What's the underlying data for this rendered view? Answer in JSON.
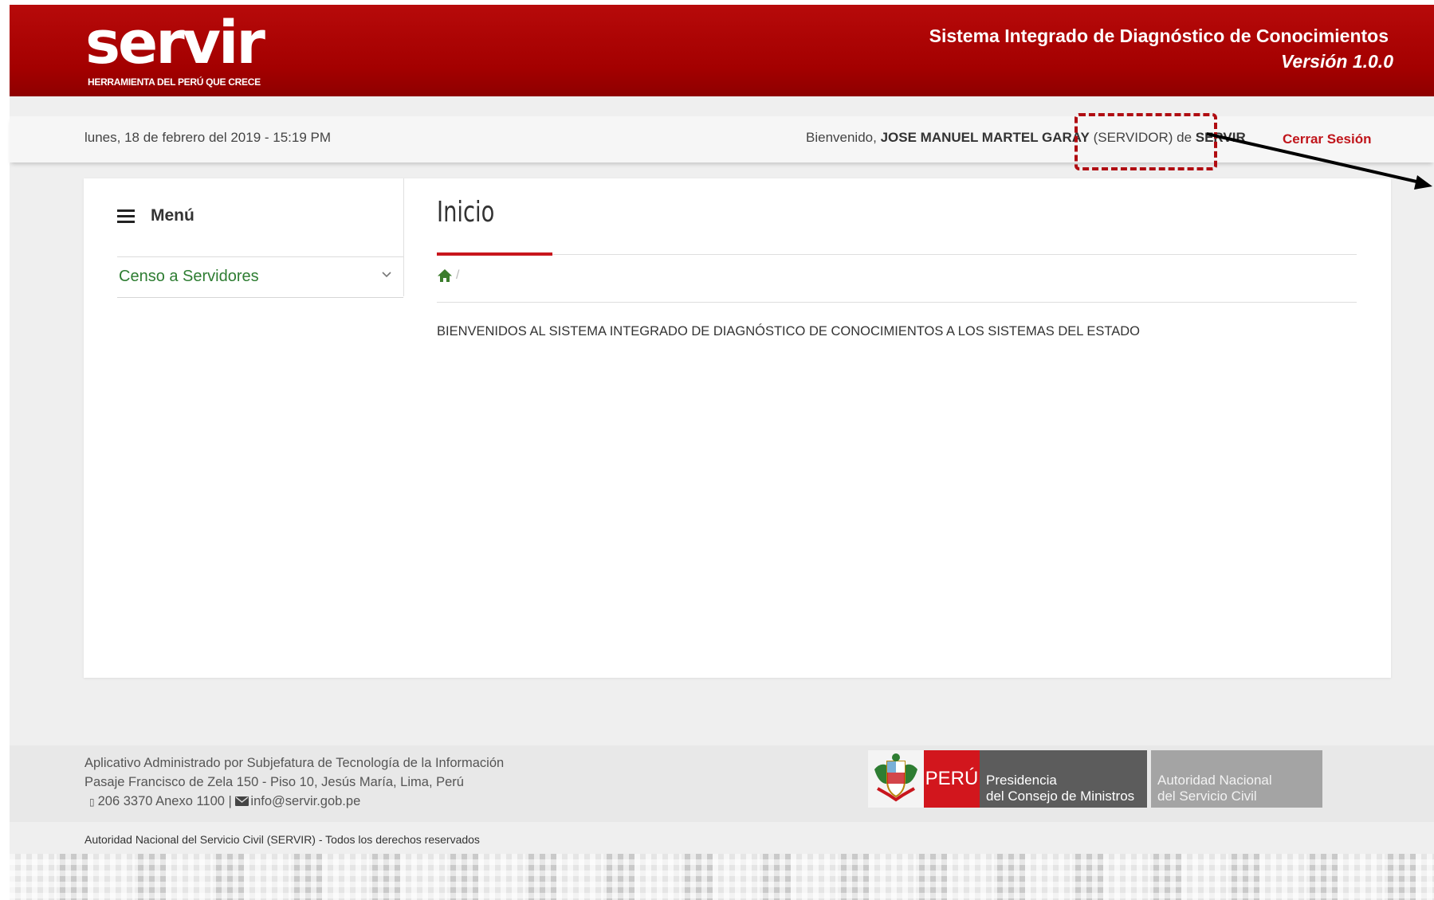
{
  "header": {
    "logo_text": "servir",
    "logo_tagline": "HERRAMIENTA DEL PERÚ QUE CRECE",
    "system_title": "Sistema Integrado de Diagnóstico de Conocimientos",
    "version": "Versión 1.0.0",
    "brand_color": "#a30000"
  },
  "userbar": {
    "date": "lunes, 18 de febrero del 2019 - 15:19 PM",
    "welcome_prefix": "Bienvenido, ",
    "user_name": "JOSE MANUEL MARTEL GARAY",
    "role": " (SERVIDOR) de ",
    "organization": "SERVIR",
    "logout": "Cerrar Sesión"
  },
  "sidebar": {
    "menu_title": "Menú",
    "items": [
      {
        "label": "Censo a Servidores",
        "icon": "chevron-down-icon"
      }
    ]
  },
  "main": {
    "title": "Inicio",
    "breadcrumb_separator": "/",
    "welcome_message": "BIENVENIDOS AL SISTEMA INTEGRADO DE DIAGNÓSTICO DE CONOCIMIENTOS A LOS SISTEMAS DEL ESTADO",
    "accent_color": "#c8161d"
  },
  "footer": {
    "line1": "Aplicativo Administrado por Subjefatura de Tecnología de la Información",
    "line2": "Pasaje Francisco de Zela 150 - Piso 10, Jesús María, Lima, Perú",
    "phone": "206 3370 Anexo 1100 | ",
    "email": "info@servir.gob.pe",
    "copyright": "Autoridad Nacional del Servicio Civil (SERVIR) - Todos los derechos reservados",
    "logos": {
      "peru": "PERÚ",
      "pcm_line1": "Presidencia",
      "pcm_line2": "del Consejo de Ministros",
      "servir_line1": "Autoridad Nacional",
      "servir_line2": "del Servicio Civil"
    }
  }
}
